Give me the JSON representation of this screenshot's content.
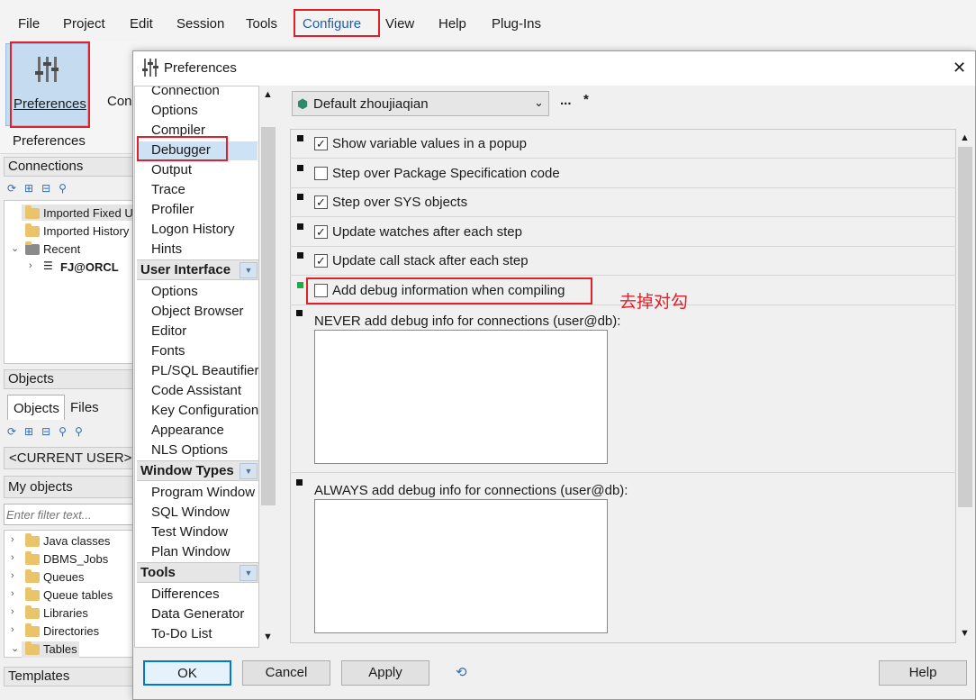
{
  "menubar": {
    "items": [
      "File",
      "Project",
      "Edit",
      "Session",
      "Tools",
      "Configure",
      "View",
      "Help",
      "Plug-Ins"
    ]
  },
  "ribbon": {
    "preferences_label": "Preferences",
    "group_label": "Preferences",
    "partial_label": "Con"
  },
  "left": {
    "connections_header": "Connections",
    "conn_tree": [
      "Imported Fixed U",
      "Imported History",
      "Recent",
      "FJ@ORCL"
    ],
    "objects_header": "Objects",
    "tabs": [
      "Objects",
      "Files"
    ],
    "current_user": "<CURRENT USER>",
    "my_objects": "My objects",
    "filter_placeholder": "Enter filter text...",
    "obj_tree": [
      "Java classes",
      "DBMS_Jobs",
      "Queues",
      "Queue tables",
      "Libraries",
      "Directories",
      "Tables"
    ],
    "templates_header": "Templates"
  },
  "dialog": {
    "title": "Preferences",
    "close_glyph": "✕",
    "categories_top": [
      "Connection",
      "Options",
      "Compiler",
      "Debugger",
      "Output",
      "Trace",
      "Profiler",
      "Logon History",
      "Hints"
    ],
    "group_ui": "User Interface",
    "categories_ui": [
      "Options",
      "Object Browser",
      "Editor",
      "Fonts",
      "PL/SQL Beautifier",
      "Code Assistant",
      "Key Configuration",
      "Appearance",
      "NLS Options"
    ],
    "group_window": "Window Types",
    "categories_window": [
      "Program Window",
      "SQL Window",
      "Test Window",
      "Plan Window"
    ],
    "group_tools": "Tools",
    "categories_tools": [
      "Differences",
      "Data Generator",
      "To-Do List"
    ],
    "profile": "Default zhoujiaqian",
    "ellipsis": "...",
    "modified_star": "*",
    "options": [
      {
        "label": "Show variable values in a popup",
        "checked": true
      },
      {
        "label": "Step over Package Specification code",
        "checked": false
      },
      {
        "label": "Step over SYS objects",
        "checked": true
      },
      {
        "label": "Update watches after each step",
        "checked": true
      },
      {
        "label": "Update call stack after each step",
        "checked": true
      },
      {
        "label": "Add debug information when compiling",
        "checked": false
      }
    ],
    "never_label": "NEVER add debug info for connections (user@db):",
    "always_label": "ALWAYS add debug info for connections (user@db):",
    "annotation": "去掉对勾",
    "buttons": {
      "ok": "OK",
      "cancel": "Cancel",
      "apply": "Apply",
      "help": "Help"
    },
    "colors": {
      "highlight_red": "#e0202a",
      "selected_bg": "#cde3f5",
      "accent_green": "#22aa44"
    }
  }
}
